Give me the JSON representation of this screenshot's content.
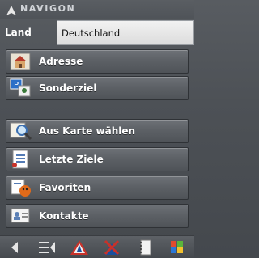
{
  "app": {
    "brand": "NAVIGON"
  },
  "country": {
    "label": "Land",
    "value": "Deutschland"
  },
  "menu": {
    "address_label": "Adresse",
    "poi_label": "Sonderziel",
    "from_map_label": "Aus Karte wählen",
    "recent_label": "Letzte Ziele",
    "favorites_label": "Favoriten",
    "contacts_label": "Kontakte"
  },
  "toolbar": {
    "icons": [
      "back-arrow-icon",
      "route-list-icon",
      "route-warning-icon",
      "cancel-route-icon",
      "notebook-icon",
      "windows-start-icon"
    ]
  },
  "colors": {
    "accent": "#1a4f9c",
    "background": "#4d5156",
    "warning_red": "#c8322a"
  }
}
